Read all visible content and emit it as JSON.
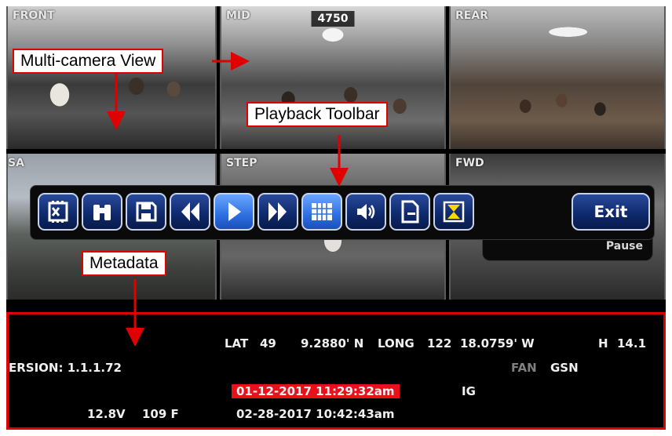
{
  "cameras": [
    {
      "label": "FRONT"
    },
    {
      "label": "MID",
      "overlay": "4750"
    },
    {
      "label": "REAR"
    },
    {
      "label": "SA"
    },
    {
      "label": "STEP"
    },
    {
      "label": "FWD"
    }
  ],
  "toolbar": {
    "buttons": [
      {
        "icon": "clip-edit-icon"
      },
      {
        "icon": "binoculars-icon"
      },
      {
        "icon": "save-icon"
      },
      {
        "icon": "rewind-icon"
      },
      {
        "icon": "play-icon"
      },
      {
        "icon": "fast-forward-icon"
      },
      {
        "icon": "grid-view-icon"
      },
      {
        "icon": "volume-icon"
      },
      {
        "icon": "document-icon"
      },
      {
        "icon": "hourglass-icon"
      }
    ],
    "exit_label": "Exit",
    "status": "Pause"
  },
  "metadata": {
    "lat_label": "LAT",
    "lat_deg": "49",
    "lat_min": "9.2880' N",
    "long_label": "LONG",
    "long_deg": "122",
    "long_min": "18.0759' W",
    "h_label": "H",
    "h_value": "14.1",
    "version": "ERSION:  1.1.1.72",
    "fan": "FAN",
    "gsn": "GSN",
    "timestamp_current": "01-12-2017  11:29:32am",
    "ig": "IG",
    "voltage": "12.8V",
    "temperature": "109  F",
    "timestamp_end": "02-28-2017  10:42:43am"
  },
  "annotations": {
    "multi_camera": "Multi-camera View",
    "playback_toolbar": "Playback Toolbar",
    "metadata": "Metadata"
  },
  "colors": {
    "highlight": "#e8101a",
    "annotation_border": "#e00000",
    "button_blue": "#0f2a6e",
    "button_active": "#2d6fe0"
  }
}
